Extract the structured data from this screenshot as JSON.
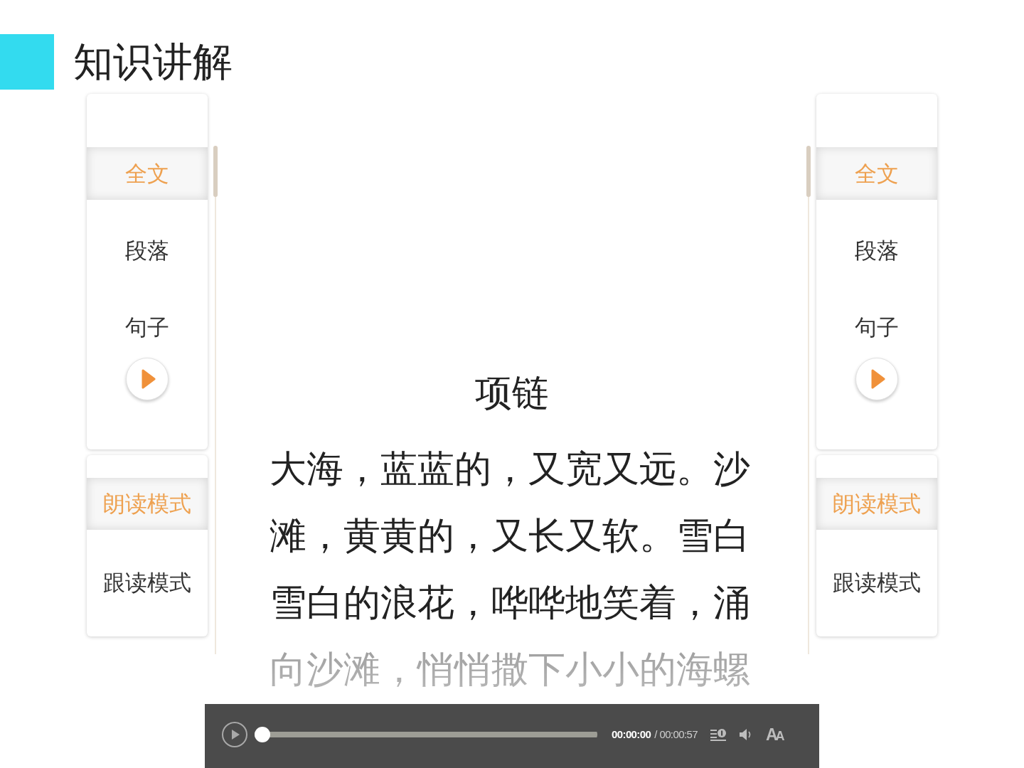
{
  "header": {
    "title": "知识讲解"
  },
  "side_panels": [
    {
      "scope_tabs": [
        {
          "label": "全文",
          "selected": true
        },
        {
          "label": "段落",
          "selected": false
        },
        {
          "label": "句子",
          "selected": false
        }
      ],
      "mode_tabs": [
        {
          "label": "朗读模式",
          "selected": true
        },
        {
          "label": "跟读模式",
          "selected": false
        }
      ]
    },
    {
      "scope_tabs": [
        {
          "label": "全文",
          "selected": true
        },
        {
          "label": "段落",
          "selected": false
        },
        {
          "label": "句子",
          "selected": false
        }
      ],
      "mode_tabs": [
        {
          "label": "朗读模式",
          "selected": true
        },
        {
          "label": "跟读模式",
          "selected": false
        }
      ]
    }
  ],
  "reading": {
    "title": "项链",
    "text": "大海，蓝蓝的，又宽又远。沙滩，黄黄的，又长又软。雪白雪白的浪花，哗哗地笑着，涌向沙滩，悄悄撒下小小的海螺"
  },
  "player": {
    "level": 0,
    "current_time": "00:00:00",
    "total_time": "/ 00:00:57",
    "font_button": "AA"
  }
}
